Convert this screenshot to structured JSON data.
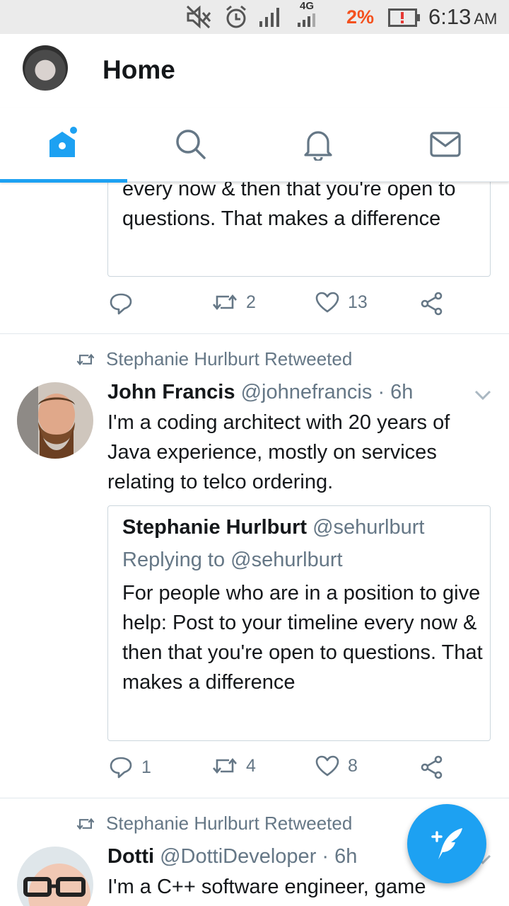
{
  "status_bar": {
    "network": "4G",
    "battery": "2%",
    "time": "6:13",
    "ampm": "AM"
  },
  "header": {
    "title": "Home"
  },
  "tabs": [
    {
      "name": "home",
      "active": true
    },
    {
      "name": "search",
      "active": false
    },
    {
      "name": "notifications",
      "active": false
    },
    {
      "name": "messages",
      "active": false
    }
  ],
  "accent_color": "#1da1f2",
  "tweet0": {
    "quote_lines": "every now & then that you're open to questions. That makes a difference",
    "replies": "",
    "retweets": "2",
    "likes": "13"
  },
  "tweet1": {
    "retweeted_by": "Stephanie Hurlburt Retweeted",
    "name": "John Francis",
    "handle": "@johnefrancis",
    "time": "· 6h",
    "text": "I'm a coding architect with 20 years of Java experience, mostly on services relating to telco ordering.",
    "quote": {
      "name": "Stephanie Hurlburt",
      "handle": "@sehurlburt",
      "replying_to": "Replying to @sehurlburt",
      "text": "For people who are in a position to give help: Post to your timeline every now & then that you're open to questions. That makes a difference"
    },
    "replies": "1",
    "retweets": "4",
    "likes": "8"
  },
  "tweet2": {
    "retweeted_by": "Stephanie Hurlburt Retweeted",
    "name": "Dotti",
    "handle": "@DottiDeveloper",
    "time": "· 6h",
    "text": "I'm a C++ software engineer, game"
  }
}
